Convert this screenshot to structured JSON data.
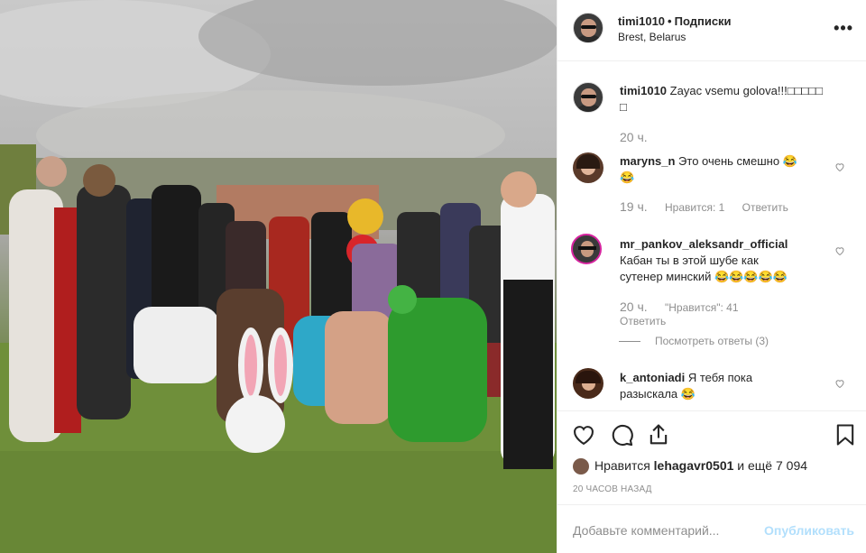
{
  "post": {
    "author": "timi1010",
    "follow_label": "Подписки",
    "location": "Brest, Belarus",
    "more_icon": "more-horizontal-icon",
    "caption_user": "timi1010",
    "caption_text": "Zayac vsemu golova!!!□□□□□",
    "caption_text_line2": "□",
    "caption_time": "20 ч."
  },
  "comments": [
    {
      "user": "maryns_n",
      "text": "Это очень смешно 😂",
      "text_line2": "😂",
      "time": "19 ч.",
      "likes": "Нравится: 1",
      "reply": "Ответить"
    },
    {
      "user": "mr_pankov_aleksandr_official",
      "text": "Кабан ты в этой шубе как",
      "text_line2": "сутенер минский 😂😂😂😂😂",
      "time": "20 ч.",
      "likes": "\"Нравится\": 41",
      "reply": "Ответить",
      "view_replies": "Посмотреть ответы (3)"
    },
    {
      "user": "k_antoniadi",
      "text": "Я тебя пока",
      "text_line2": "разыскала 😂"
    }
  ],
  "actions": {
    "like_icon": "heart-icon",
    "comment_icon": "comment-icon",
    "share_icon": "share-icon",
    "save_icon": "bookmark-icon",
    "likes_prefix": "Нравится",
    "likes_user": "lehagavr0501",
    "likes_suffix": "и ещё 7 094",
    "time_ago": "20 ЧАСОВ НАЗАД"
  },
  "add_comment": {
    "placeholder": "Добавьте комментарий...",
    "publish_label": "Опубликовать"
  }
}
